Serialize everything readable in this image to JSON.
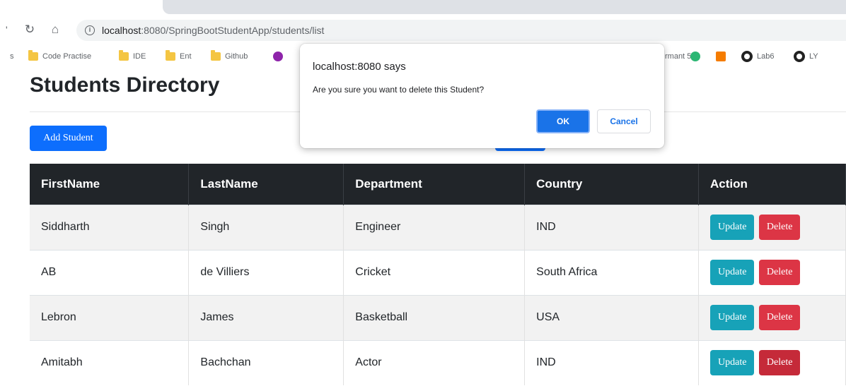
{
  "browser": {
    "nav_fragment": "'",
    "url_host": "localhost",
    "url_path": ":8080/SpringBootStudentApp/students/list",
    "bookmarks_prefix": "s",
    "bookmarks": [
      {
        "label": "Code Practise"
      },
      {
        "label": "IDE"
      },
      {
        "label": "Ent"
      },
      {
        "label": "Github"
      }
    ],
    "bookmarks_right": [
      {
        "label": "rmant 5"
      },
      {
        "label": "Lab6"
      },
      {
        "label": "LY"
      }
    ]
  },
  "page": {
    "title": "Students Directory",
    "add_button": "Add Student"
  },
  "table": {
    "headers": [
      "FirstName",
      "LastName",
      "Department",
      "Country",
      "Action"
    ],
    "rows": [
      {
        "first": "Siddharth",
        "last": "Singh",
        "dept": "Engineer",
        "country": "IND"
      },
      {
        "first": "AB",
        "last": "de Villiers",
        "dept": "Cricket",
        "country": "South Africa"
      },
      {
        "first": "Lebron",
        "last": "James",
        "dept": "Basketball",
        "country": "USA"
      },
      {
        "first": "Amitabh",
        "last": "Bachchan",
        "dept": "Actor",
        "country": "IND"
      }
    ],
    "update_label": "Update",
    "delete_label": "Delete"
  },
  "dialog": {
    "title": "localhost:8080 says",
    "message": "Are you sure you want to delete this Student?",
    "ok": "OK",
    "cancel": "Cancel"
  },
  "colors": {
    "primary": "#0d6efd",
    "info": "#17a2b8",
    "danger": "#dc3545",
    "dark": "#212529",
    "dialog_accent": "#1a73e8"
  }
}
